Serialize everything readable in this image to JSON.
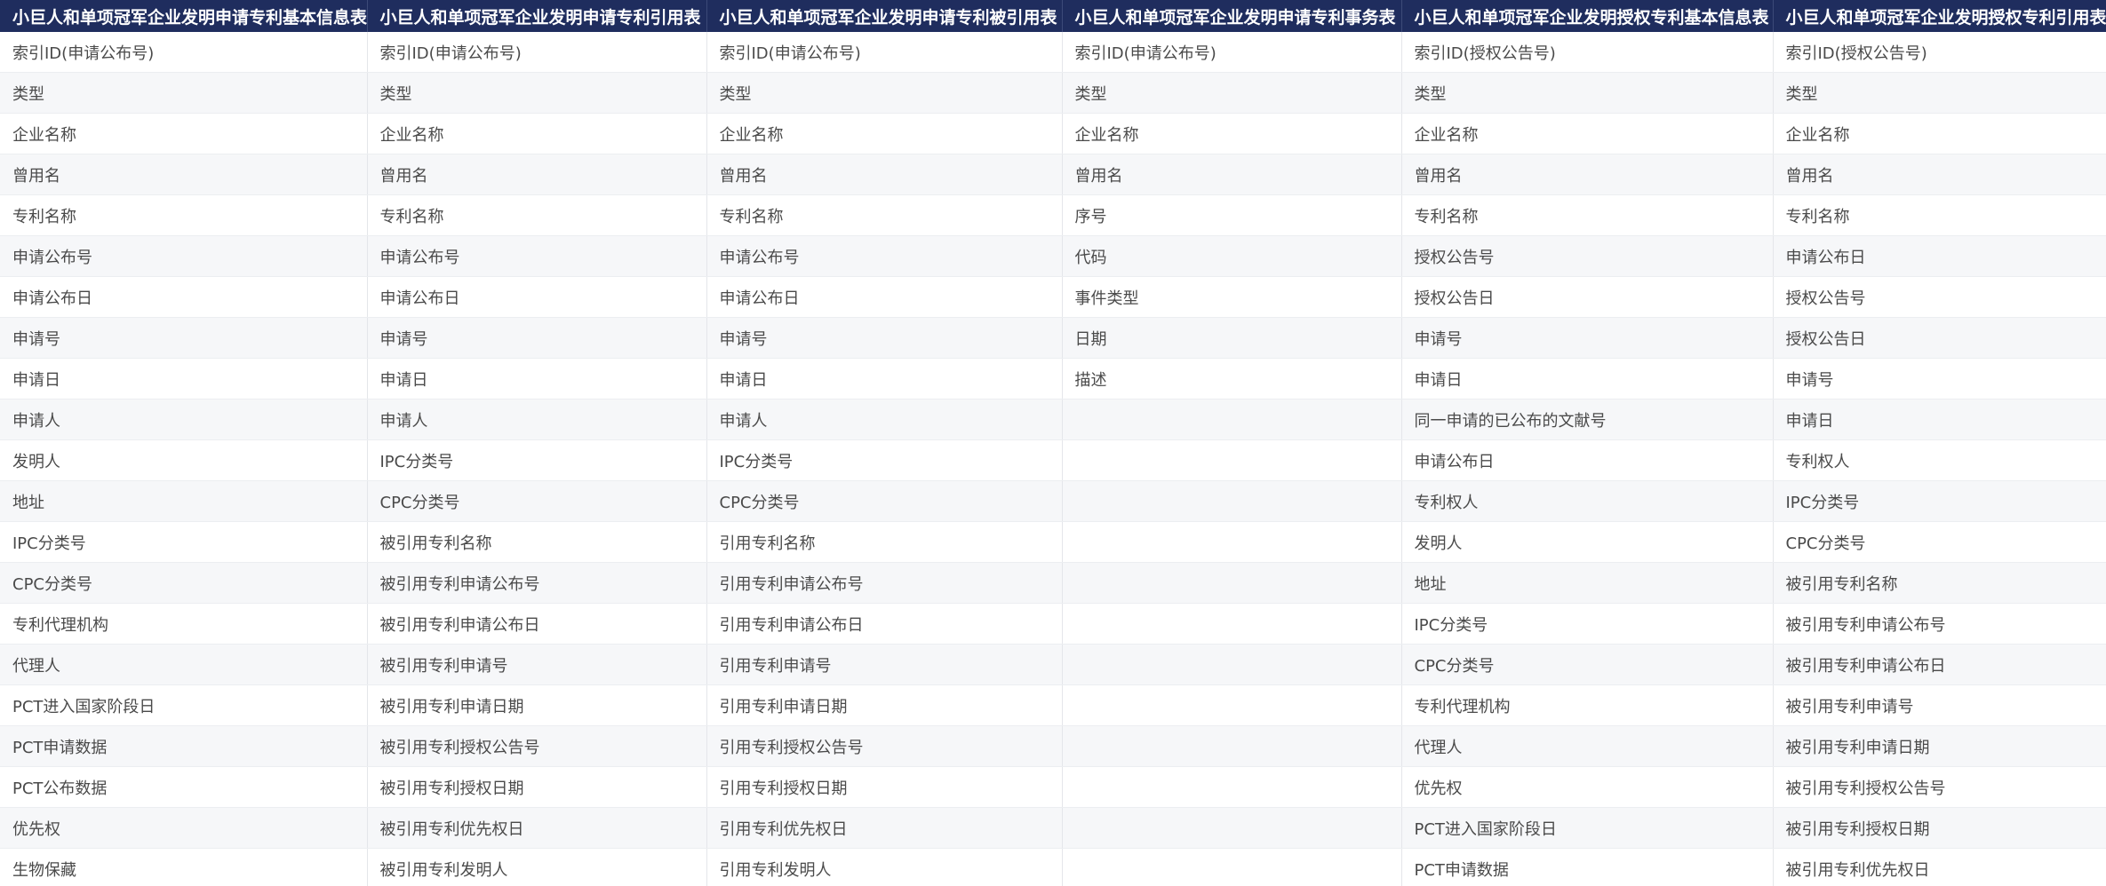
{
  "table": {
    "headers": [
      "小巨人和单项冠军企业发明申请专利基本信息表",
      "小巨人和单项冠军企业发明申请专利引用表",
      "小巨人和单项冠军企业发明申请专利被引用表",
      "小巨人和单项冠军企业发明申请专利事务表",
      "小巨人和单项冠军企业发明授权专利基本信息表",
      "小巨人和单项冠军企业发明授权专利引用表"
    ],
    "rows": [
      [
        "索引ID(申请公布号)",
        "索引ID(申请公布号)",
        "索引ID(申请公布号)",
        "索引ID(申请公布号)",
        "索引ID(授权公告号)",
        "索引ID(授权公告号)"
      ],
      [
        "类型",
        "类型",
        "类型",
        "类型",
        "类型",
        "类型"
      ],
      [
        "企业名称",
        "企业名称",
        "企业名称",
        "企业名称",
        "企业名称",
        "企业名称"
      ],
      [
        "曾用名",
        "曾用名",
        "曾用名",
        "曾用名",
        "曾用名",
        "曾用名"
      ],
      [
        "专利名称",
        "专利名称",
        "专利名称",
        "序号",
        "专利名称",
        "专利名称"
      ],
      [
        "申请公布号",
        "申请公布号",
        "申请公布号",
        "代码",
        "授权公告号",
        "申请公布日"
      ],
      [
        "申请公布日",
        "申请公布日",
        "申请公布日",
        "事件类型",
        "授权公告日",
        "授权公告号"
      ],
      [
        "申请号",
        "申请号",
        "申请号",
        "日期",
        "申请号",
        "授权公告日"
      ],
      [
        "申请日",
        "申请日",
        "申请日",
        "描述",
        "申请日",
        "申请号"
      ],
      [
        "申请人",
        "申请人",
        "申请人",
        "",
        "同一申请的已公布的文献号",
        "申请日"
      ],
      [
        "发明人",
        "IPC分类号",
        "IPC分类号",
        "",
        "申请公布日",
        "专利权人"
      ],
      [
        "地址",
        "CPC分类号",
        "CPC分类号",
        "",
        "专利权人",
        "IPC分类号"
      ],
      [
        "IPC分类号",
        "被引用专利名称",
        "引用专利名称",
        "",
        "发明人",
        "CPC分类号"
      ],
      [
        "CPC分类号",
        "被引用专利申请公布号",
        "引用专利申请公布号",
        "",
        "地址",
        "被引用专利名称"
      ],
      [
        "专利代理机构",
        "被引用专利申请公布日",
        "引用专利申请公布日",
        "",
        "IPC分类号",
        "被引用专利申请公布号"
      ],
      [
        "代理人",
        "被引用专利申请号",
        "引用专利申请号",
        "",
        "CPC分类号",
        "被引用专利申请公布日"
      ],
      [
        "PCT进入国家阶段日",
        "被引用专利申请日期",
        "引用专利申请日期",
        "",
        "专利代理机构",
        "被引用专利申请号"
      ],
      [
        "PCT申请数据",
        "被引用专利授权公告号",
        "引用专利授权公告号",
        "",
        "代理人",
        "被引用专利申请日期"
      ],
      [
        "PCT公布数据",
        "被引用专利授权日期",
        "引用专利授权日期",
        "",
        "优先权",
        "被引用专利授权公告号"
      ],
      [
        "优先权",
        "被引用专利优先权日",
        "引用专利优先权日",
        "",
        "PCT进入国家阶段日",
        "被引用专利授权日期"
      ],
      [
        "生物保藏",
        "被引用专利发明人",
        "引用专利发明人",
        "",
        "PCT申请数据",
        "被引用专利优先权日"
      ]
    ]
  },
  "colors": {
    "header_bg": "#1f2d5e",
    "header_text": "#ffffff",
    "row_alt_bg": "#f6f7f9",
    "cell_text": "#4a4a4a"
  }
}
